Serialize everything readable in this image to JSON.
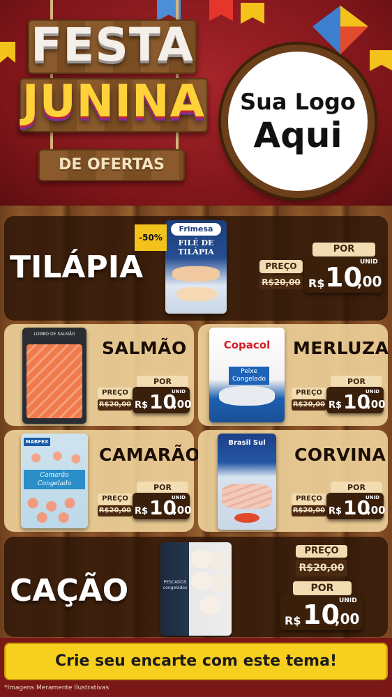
{
  "header": {
    "title_line1": "FESTA",
    "title_line2": "JUNINA",
    "title_line3": "DE OFERTAS",
    "logo_line1": "Sua Logo",
    "logo_line2": "Aqui"
  },
  "colors": {
    "background_red": "#8a1c20",
    "wood": "#7a4520",
    "cta_yellow": "#f6cf1f",
    "badge_yellow": "#f3c21b"
  },
  "products": {
    "tilapia": {
      "name": "TILÁPIA",
      "brand": "Frimesa",
      "package_text": "FILÉ DE TILÁPIA",
      "discount": "-50%",
      "preco_label": "PREÇO",
      "old_price": "R$20,00",
      "por_label": "POR",
      "currency": "R$",
      "price_int": "10",
      "price_cents": ",00",
      "unit": "UNID"
    },
    "salmao": {
      "name": "SALMÃO",
      "package_text": "LOMBO DE SALMÃO",
      "preco_label": "PREÇO",
      "old_price": "R$20,00",
      "por_label": "POR",
      "currency": "R$",
      "price_int": "10",
      "price_cents": ",00",
      "unit": "UNID"
    },
    "merluza": {
      "name": "MERLUZA",
      "brand": "Copacol",
      "package_text": "Peixe Congelado",
      "preco_label": "PREÇO",
      "old_price": "R$20,00",
      "por_label": "POR",
      "currency": "R$",
      "price_int": "10",
      "price_cents": ",00",
      "unit": "UNID"
    },
    "camarao": {
      "name": "CAMARÃO",
      "brand": "MARFEX",
      "package_text": "Camarão Congelado",
      "preco_label": "PREÇO",
      "old_price": "R$20,00",
      "por_label": "POR",
      "currency": "R$",
      "price_int": "10",
      "price_cents": ",00",
      "unit": "UNID"
    },
    "corvina": {
      "name": "CORVINA",
      "brand": "Brasil Sul",
      "preco_label": "PREÇO",
      "old_price": "R$20,00",
      "por_label": "POR",
      "currency": "R$",
      "price_int": "10",
      "price_cents": ",00",
      "unit": "UNID"
    },
    "cacao": {
      "name": "CAÇÃO",
      "package_text": "PESCADOS congelados",
      "preco_label": "PREÇO",
      "old_price": "R$20,00",
      "por_label": "POR",
      "currency": "R$",
      "price_int": "10",
      "price_cents": ",00",
      "unit": "UNID"
    }
  },
  "footer": {
    "cta_label": "Crie seu encarte com este tema!",
    "disclaimer": "*Imagens Meramente Ilustrativas"
  }
}
